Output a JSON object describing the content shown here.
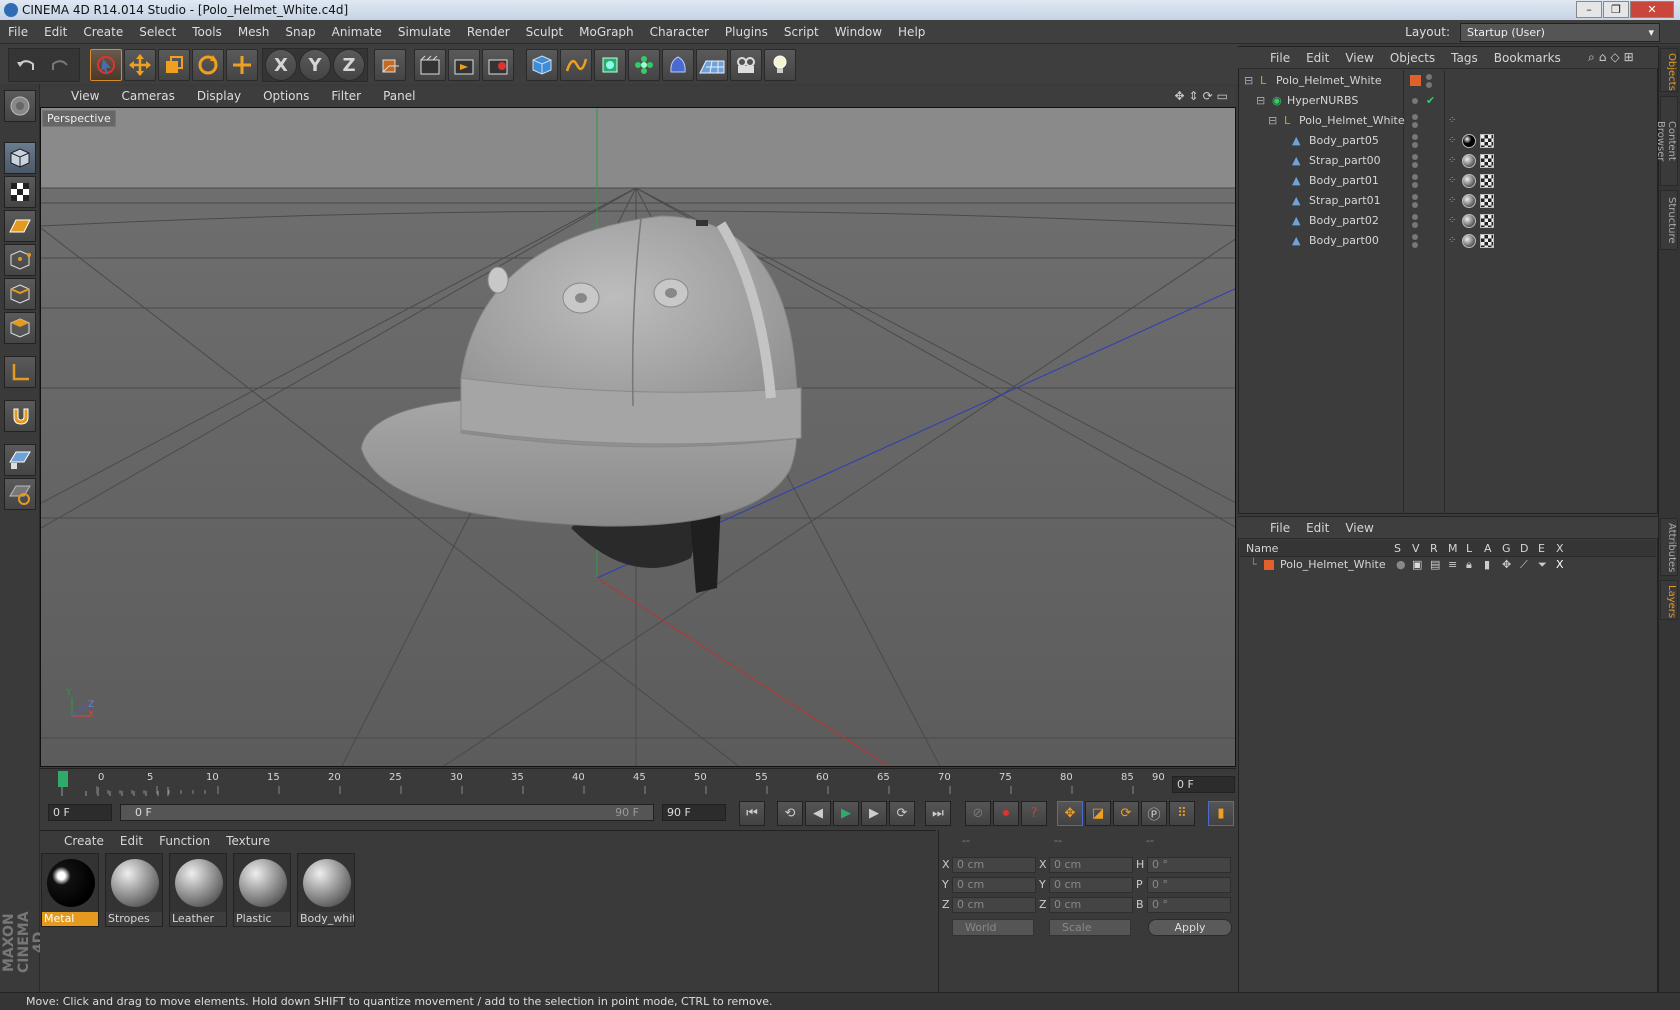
{
  "window": {
    "title": "CINEMA 4D R14.014 Studio - [Polo_Helmet_White.c4d]",
    "controls": [
      "–",
      "❐",
      "✕"
    ]
  },
  "menubar": {
    "items": [
      "File",
      "Edit",
      "Create",
      "Select",
      "Tools",
      "Mesh",
      "Snap",
      "Animate",
      "Simulate",
      "Render",
      "Sculpt",
      "MoGraph",
      "Character",
      "Plugins",
      "Script",
      "Window",
      "Help"
    ],
    "layout_label": "Layout:",
    "layout_value": "Startup (User)"
  },
  "toolbar": {
    "axis_x": "X",
    "axis_y": "Y",
    "axis_z": "Z",
    "icons": [
      "undo-icon",
      "redo-icon",
      "select-icon",
      "move-icon",
      "scale-icon",
      "rotate-icon",
      "add-icon",
      "x-axis-icon",
      "y-axis-icon",
      "z-axis-icon",
      "coordinate-system-icon",
      "render-view-icon",
      "render-picture-viewer-icon",
      "edit-render-settings-icon",
      "cube-icon",
      "spline-icon",
      "nurbs-icon",
      "array-icon",
      "deformer-icon",
      "floor-icon",
      "camera-icon",
      "light-icon"
    ]
  },
  "viewport": {
    "menu": [
      "View",
      "Cameras",
      "Display",
      "Options",
      "Filter",
      "Panel"
    ],
    "label": "Perspective",
    "axis_y": "Y",
    "axis_z": "Z",
    "axis_x": "X"
  },
  "timeline": {
    "ticks": [
      "0",
      "5",
      "10",
      "15",
      "20",
      "25",
      "30",
      "35",
      "40",
      "45",
      "50",
      "55",
      "60",
      "65",
      "70",
      "75",
      "80",
      "85",
      "90"
    ],
    "current_frame_display": "0 F"
  },
  "transport": {
    "current": "0 F",
    "range_start": "0 F",
    "range_end_inner": "90 F",
    "range_end": "90 F"
  },
  "materials": {
    "menu": [
      "Create",
      "Edit",
      "Function",
      "Texture"
    ],
    "items": [
      {
        "name": "Metal",
        "selected": true
      },
      {
        "name": "Stropes",
        "selected": false
      },
      {
        "name": "Leather",
        "selected": false
      },
      {
        "name": "Plastic",
        "selected": false
      },
      {
        "name": "Body_white",
        "selected": false
      }
    ]
  },
  "coordinates": {
    "header": [
      "--",
      "--",
      "--"
    ],
    "rows": [
      {
        "l1": "X",
        "v1": "0 cm",
        "l2": "X",
        "v2": "0 cm",
        "l3": "H",
        "v3": "0 °"
      },
      {
        "l1": "Y",
        "v1": "0 cm",
        "l2": "Y",
        "v2": "0 cm",
        "l3": "P",
        "v3": "0 °"
      },
      {
        "l1": "Z",
        "v1": "0 cm",
        "l2": "Z",
        "v2": "0 cm",
        "l3": "B",
        "v3": "0 °"
      }
    ],
    "space": "World",
    "mode": "Scale",
    "apply": "Apply"
  },
  "objects": {
    "menu": [
      "File",
      "Edit",
      "View",
      "Objects",
      "Tags",
      "Bookmarks"
    ],
    "tree": [
      {
        "name": "Polo_Helmet_White",
        "depth": 0,
        "type": "null"
      },
      {
        "name": "HyperNURBS",
        "depth": 1,
        "type": "nurbs"
      },
      {
        "name": "Polo_Helmet_White",
        "depth": 2,
        "type": "null"
      },
      {
        "name": "Body_part05",
        "depth": 3,
        "type": "mesh"
      },
      {
        "name": "Strap_part00",
        "depth": 3,
        "type": "mesh"
      },
      {
        "name": "Body_part01",
        "depth": 3,
        "type": "mesh"
      },
      {
        "name": "Strap_part01",
        "depth": 3,
        "type": "mesh"
      },
      {
        "name": "Body_part02",
        "depth": 3,
        "type": "mesh"
      },
      {
        "name": "Body_part00",
        "depth": 3,
        "type": "mesh"
      }
    ]
  },
  "layers": {
    "menu": [
      "File",
      "Edit",
      "View"
    ],
    "header": {
      "name": "Name",
      "cols": [
        "S",
        "V",
        "R",
        "M",
        "L",
        "A",
        "G",
        "D",
        "E",
        "X"
      ]
    },
    "rows": [
      {
        "name": "Polo_Helmet_White",
        "color": "#e0622a"
      }
    ]
  },
  "sidebar_tabs": [
    "Objects",
    "Content Browser",
    "Structure",
    "Attributes",
    "Layers"
  ],
  "branding": "MAXON CINEMA 4D",
  "status": "Move: Click and drag to move elements. Hold down SHIFT to quantize movement / add to the selection in point mode, CTRL to remove.",
  "colors": {
    "accent": "#e39a1e",
    "selection": "#d68a2a",
    "x_axis": "#c0392b",
    "y_axis": "#27ae60",
    "z_axis": "#2d3db8"
  }
}
